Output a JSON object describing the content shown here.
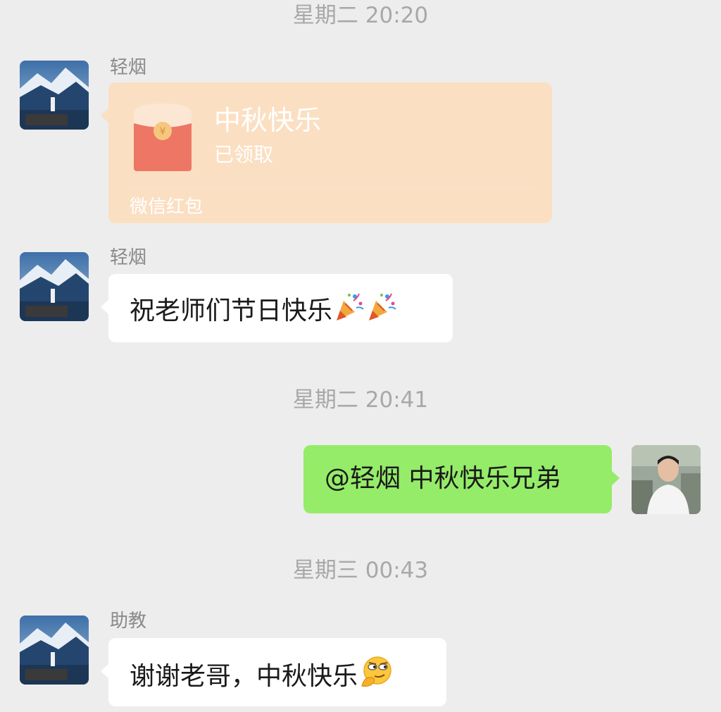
{
  "timestamps": {
    "t1": "星期二 20:20",
    "t2": "星期二 20:41",
    "t3": "星期三 00:43"
  },
  "messages": [
    {
      "sender": "轻烟",
      "type": "red_packet",
      "red_packet": {
        "title": "中秋快乐",
        "status": "已领取",
        "footer": "微信红包"
      }
    },
    {
      "sender": "轻烟",
      "type": "text",
      "text": "祝老师们节日快乐",
      "emojis": [
        "party-popper-icon",
        "party-popper-icon"
      ]
    },
    {
      "sender": "me",
      "type": "text",
      "text": "@轻烟 中秋快乐兄弟"
    },
    {
      "sender": "助教",
      "type": "text",
      "text": "谢谢老哥，中秋快乐",
      "emojis": [
        "smirk-thinking-face-icon"
      ]
    }
  ],
  "colors": {
    "background": "#ededed",
    "bubble_incoming": "#ffffff",
    "bubble_outgoing": "#95ec69",
    "red_packet": "#fbdfc2",
    "timestamp_text": "#a8a8a8",
    "sender_name_text": "#8a8a8a"
  }
}
